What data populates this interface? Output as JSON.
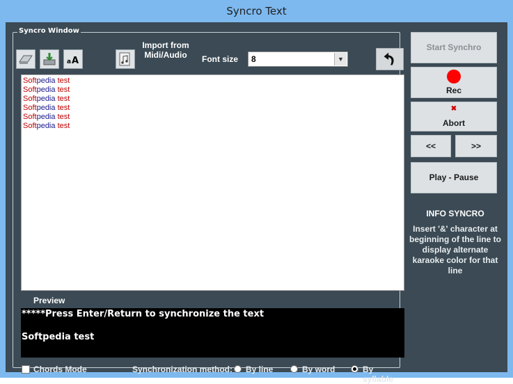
{
  "window": {
    "title": "Syncro Text"
  },
  "group": {
    "legend": "Syncro Window"
  },
  "toolbar": {
    "import_label_line1": "Import from",
    "import_label_line2": "Midi/Audio",
    "font_size_label": "Font size",
    "font_size_value": "8"
  },
  "editor": {
    "lines": [
      {
        "p1": "Soft",
        "p2": "pedia ",
        "p3": "test"
      },
      {
        "p1": "Soft",
        "p2": "pedia ",
        "p3": "test"
      },
      {
        "p1": "Soft",
        "p2": "pedia ",
        "p3": "test"
      },
      {
        "p1": "Soft",
        "p2": "pedia ",
        "p3": "test"
      },
      {
        "p1": "Soft",
        "p2": "pedia ",
        "p3": "test"
      },
      {
        "p1": "Soft",
        "p2": "pedia ",
        "p3": "test"
      }
    ]
  },
  "preview": {
    "label": "Preview",
    "line1": "*****Press Enter/Return to synchronize the text",
    "line2": "Softpedia test"
  },
  "bottom": {
    "chords_mode": "Chords Mode",
    "sync_method_label": "Synchronization method:",
    "by_line": "By line",
    "by_word": "By word",
    "by_syllable": "By syllable"
  },
  "right": {
    "start_syncro": "Start Synchro",
    "rec": "Rec",
    "abort": "Abort",
    "prev": "<<",
    "next": ">>",
    "play_pause": "Play - Pause"
  },
  "info": {
    "title": "INFO SYNCRO",
    "text": "Insert '&' character at beginning of the line to display alternate karaoke color for that line"
  },
  "colors": {
    "rec": "#ff0000",
    "abort_x": "#cc0000",
    "editor_red": "#c00000",
    "editor_blue": "#1a1a8c"
  }
}
